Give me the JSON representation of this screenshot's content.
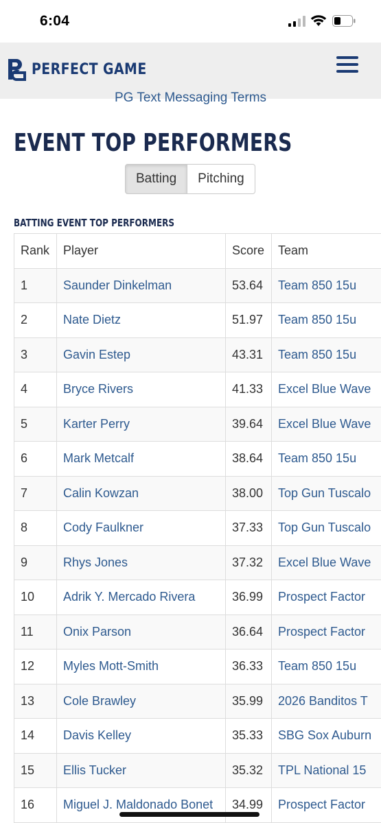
{
  "status_bar": {
    "time": "6:04"
  },
  "header": {
    "logo_text": "PERFECT GAME"
  },
  "cut_link": "PG Text Messaging Terms",
  "page_title": "EVENT TOP PERFORMERS",
  "toggle": {
    "batting": "Batting",
    "pitching": "Pitching",
    "active": "Batting"
  },
  "section_title": "BATTING EVENT TOP PERFORMERS",
  "table": {
    "headers": {
      "rank": "Rank",
      "player": "Player",
      "score": "Score",
      "team": "Team"
    },
    "rows": [
      {
        "rank": "1",
        "player": "Saunder Dinkelman",
        "score": "53.64",
        "team": "Team 850 15u"
      },
      {
        "rank": "2",
        "player": "Nate Dietz",
        "score": "51.97",
        "team": "Team 850 15u"
      },
      {
        "rank": "3",
        "player": "Gavin Estep",
        "score": "43.31",
        "team": "Team 850 15u"
      },
      {
        "rank": "4",
        "player": "Bryce Rivers",
        "score": "41.33",
        "team": "Excel Blue Wave"
      },
      {
        "rank": "5",
        "player": "Karter Perry",
        "score": "39.64",
        "team": "Excel Blue Wave"
      },
      {
        "rank": "6",
        "player": "Mark Metcalf",
        "score": "38.64",
        "team": "Team 850 15u"
      },
      {
        "rank": "7",
        "player": "Calin Kowzan",
        "score": "38.00",
        "team": "Top Gun Tuscalo"
      },
      {
        "rank": "8",
        "player": "Cody Faulkner",
        "score": "37.33",
        "team": "Top Gun Tuscalo"
      },
      {
        "rank": "9",
        "player": "Rhys Jones",
        "score": "37.32",
        "team": "Excel Blue Wave"
      },
      {
        "rank": "10",
        "player": "Adrik Y. Mercado Rivera",
        "score": "36.99",
        "team": "Prospect Factor"
      },
      {
        "rank": "11",
        "player": "Onix Parson",
        "score": "36.64",
        "team": "Prospect Factor"
      },
      {
        "rank": "12",
        "player": "Myles Mott-Smith",
        "score": "36.33",
        "team": "Team 850 15u"
      },
      {
        "rank": "13",
        "player": "Cole Brawley",
        "score": "35.99",
        "team": "2026 Banditos T"
      },
      {
        "rank": "14",
        "player": "Davis Kelley",
        "score": "35.33",
        "team": "SBG Sox Auburn"
      },
      {
        "rank": "15",
        "player": "Ellis Tucker",
        "score": "35.32",
        "team": "TPL National 15"
      },
      {
        "rank": "16",
        "player": "Miguel J. Maldonado Bonet",
        "score": "34.99",
        "team": "Prospect Factor"
      }
    ]
  },
  "colors": {
    "brand_navy": "#1a3a73",
    "link_blue": "#2e5a8f",
    "header_bg": "#eeeeee"
  },
  "icons": [
    "signal-icon",
    "wifi-icon",
    "battery-icon",
    "pg-logo-icon",
    "hamburger-menu-icon"
  ]
}
